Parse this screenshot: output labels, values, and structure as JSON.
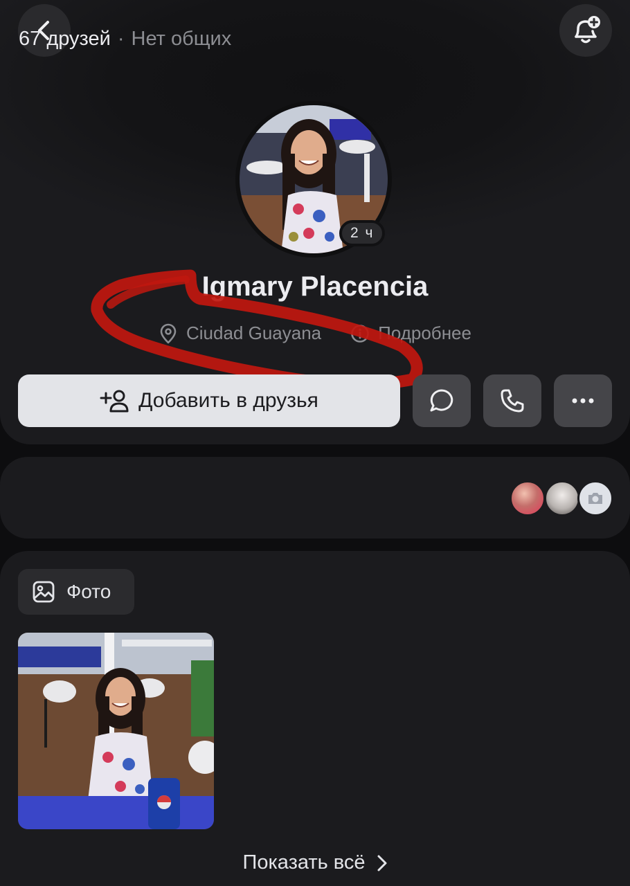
{
  "header": {
    "back_icon": "chevron-left-icon",
    "notify_icon": "bell-plus-icon"
  },
  "profile": {
    "name": "Igmary Placencia",
    "story_time": "2 ч",
    "location": "Ciudad Guayana",
    "details_label": "Подробнее"
  },
  "actions": {
    "add_friend_label": "Добавить в друзья",
    "message_icon": "message-bubble-icon",
    "call_icon": "phone-icon",
    "more_icon": "more-dots-icon"
  },
  "friends": {
    "count": "67 друзей",
    "separator": "·",
    "common": "Нет общих"
  },
  "photos": {
    "tab_label": "Фото",
    "show_all_label": "Показать всё"
  },
  "colors": {
    "background": "#0d0d0f",
    "card": "#1b1b1e",
    "button_light": "#e3e4e8",
    "button_dark": "#454549",
    "scribble": "#c0170f"
  }
}
